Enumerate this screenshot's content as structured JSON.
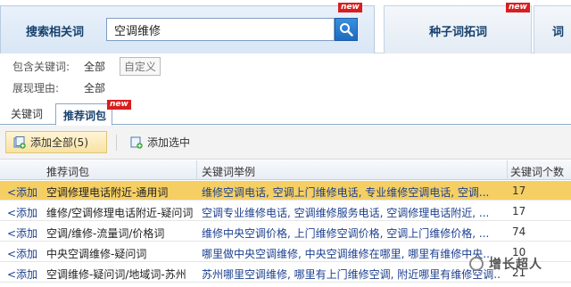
{
  "top": {
    "search_label": "搜索相关词",
    "search_value": "空调维修",
    "new_badge": "new",
    "seed_tab_label": "种子词拓词",
    "extra_tab_label": "词"
  },
  "filters": {
    "include_label": "包含关键词:",
    "include_value": "全部",
    "custom_label": "自定义",
    "reason_label": "展现理由:",
    "reason_value": "全部"
  },
  "subtabs": {
    "keywords": "关键词",
    "recommended": "推荐词包"
  },
  "toolbar": {
    "add_all": "添加全部(5)",
    "add_selected": "添加选中"
  },
  "table": {
    "headers": [
      "推荐词包",
      "关键词举例",
      "关键词个数"
    ],
    "rows": [
      {
        "action": "<添加",
        "package": "空调修理电话附近-通用词",
        "examples": "维修空调电话, 空调上门维修电话, 专业维修空调电话, 空调...",
        "count": "17",
        "selected": true
      },
      {
        "action": "<添加",
        "package": "维修/空调修理电话附近-疑问词",
        "examples": "空调专业维修电话, 空调维修服务电话, 空调修理电话附近, ...",
        "count": "17",
        "selected": false
      },
      {
        "action": "<添加",
        "package": "空调/维修-流量词/价格词",
        "examples": "维修中央空调价格, 上门维修空调价格, 空调上门维修价格, ...",
        "count": "74",
        "selected": false
      },
      {
        "action": "<添加",
        "package": "中央空调维修-疑问词",
        "examples": "哪里做中央空调维修, 中央空调维修在哪里, 哪里有维修中央...",
        "count": "10",
        "selected": false
      },
      {
        "action": "<添加",
        "package": "空调维修-疑问词/地域词-苏州",
        "examples": "苏州哪里空调维修, 哪里有上门维修空调, 附近哪里有维修空调...",
        "count": "21",
        "selected": false
      }
    ]
  },
  "watermark": "增长超人"
}
